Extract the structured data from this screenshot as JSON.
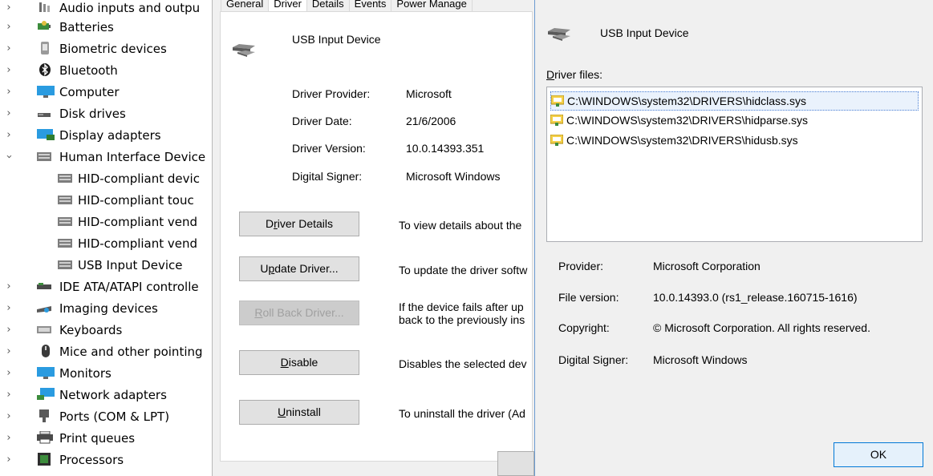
{
  "tree": {
    "items": [
      {
        "label": "Audio inputs and outpu",
        "icon": "audio-device-icon"
      },
      {
        "label": "Batteries",
        "icon": "battery-icon"
      },
      {
        "label": "Biometric devices",
        "icon": "biometric-icon"
      },
      {
        "label": "Bluetooth",
        "icon": "bluetooth-icon"
      },
      {
        "label": "Computer",
        "icon": "computer-icon"
      },
      {
        "label": "Disk drives",
        "icon": "disk-drive-icon"
      },
      {
        "label": "Display adapters",
        "icon": "display-adapter-icon"
      },
      {
        "label": "Human Interface Device",
        "icon": "hid-icon"
      },
      {
        "label": "HID-compliant devic",
        "icon": "hid-icon"
      },
      {
        "label": "HID-compliant touc",
        "icon": "hid-icon"
      },
      {
        "label": "HID-compliant vend",
        "icon": "hid-icon"
      },
      {
        "label": "HID-compliant vend",
        "icon": "hid-icon"
      },
      {
        "label": "USB Input Device",
        "icon": "hid-icon"
      },
      {
        "label": "IDE ATA/ATAPI controlle",
        "icon": "ide-controller-icon"
      },
      {
        "label": "Imaging devices",
        "icon": "imaging-icon"
      },
      {
        "label": "Keyboards",
        "icon": "keyboard-icon"
      },
      {
        "label": "Mice and other pointing",
        "icon": "mouse-icon"
      },
      {
        "label": "Monitors",
        "icon": "monitor-icon"
      },
      {
        "label": "Network adapters",
        "icon": "network-icon"
      },
      {
        "label": "Ports (COM & LPT)",
        "icon": "port-icon"
      },
      {
        "label": "Print queues",
        "icon": "printer-icon"
      },
      {
        "label": "Processors",
        "icon": "processor-icon"
      }
    ]
  },
  "properties": {
    "tabs": [
      "General",
      "Driver",
      "Details",
      "Events",
      "Power Manage"
    ],
    "active_tab": "Driver",
    "device_name": "USB Input Device",
    "fields": [
      {
        "label": "Driver Provider:",
        "value": "Microsoft"
      },
      {
        "label": "Driver Date:",
        "value": "21/6/2006"
      },
      {
        "label": "Driver Version:",
        "value": "10.0.14393.351"
      },
      {
        "label": "Digital Signer:",
        "value": "Microsoft Windows"
      }
    ],
    "buttons": [
      {
        "pre": "D",
        "acc": "r",
        "post": "iver Details",
        "desc": "To view details about the"
      },
      {
        "pre": "U",
        "acc": "p",
        "post": "date Driver...",
        "desc": "To update the driver softw"
      },
      {
        "pre": "",
        "acc": "R",
        "post": "oll Back Driver...",
        "desc": "If the device fails after up",
        "desc2": "back to the previously ins"
      },
      {
        "pre": "",
        "acc": "D",
        "post": "isable",
        "desc": "Disables the selected dev"
      },
      {
        "pre": "",
        "acc": "U",
        "post": "ninstall",
        "desc": "To uninstall the driver (Ad"
      }
    ]
  },
  "file_details": {
    "device_name": "USB Input Device",
    "files_label_acc": "D",
    "files_label_rest": "river files:",
    "files": [
      "C:\\WINDOWS\\system32\\DRIVERS\\hidclass.sys",
      "C:\\WINDOWS\\system32\\DRIVERS\\hidparse.sys",
      "C:\\WINDOWS\\system32\\DRIVERS\\hidusb.sys"
    ],
    "info": [
      {
        "label": "Provider:",
        "value": "Microsoft Corporation"
      },
      {
        "label": "File version:",
        "value": "10.0.14393.0 (rs1_release.160715-1616)"
      },
      {
        "label": "Copyright:",
        "value": "© Microsoft Corporation. All rights reserved."
      },
      {
        "label": "Digital Signer:",
        "value": "Microsoft Windows"
      }
    ],
    "ok_label": "OK"
  },
  "colors": {
    "accent": "#0078d7",
    "selection": "#eaf2fc",
    "dialog_bg": "#f0f0f0"
  }
}
